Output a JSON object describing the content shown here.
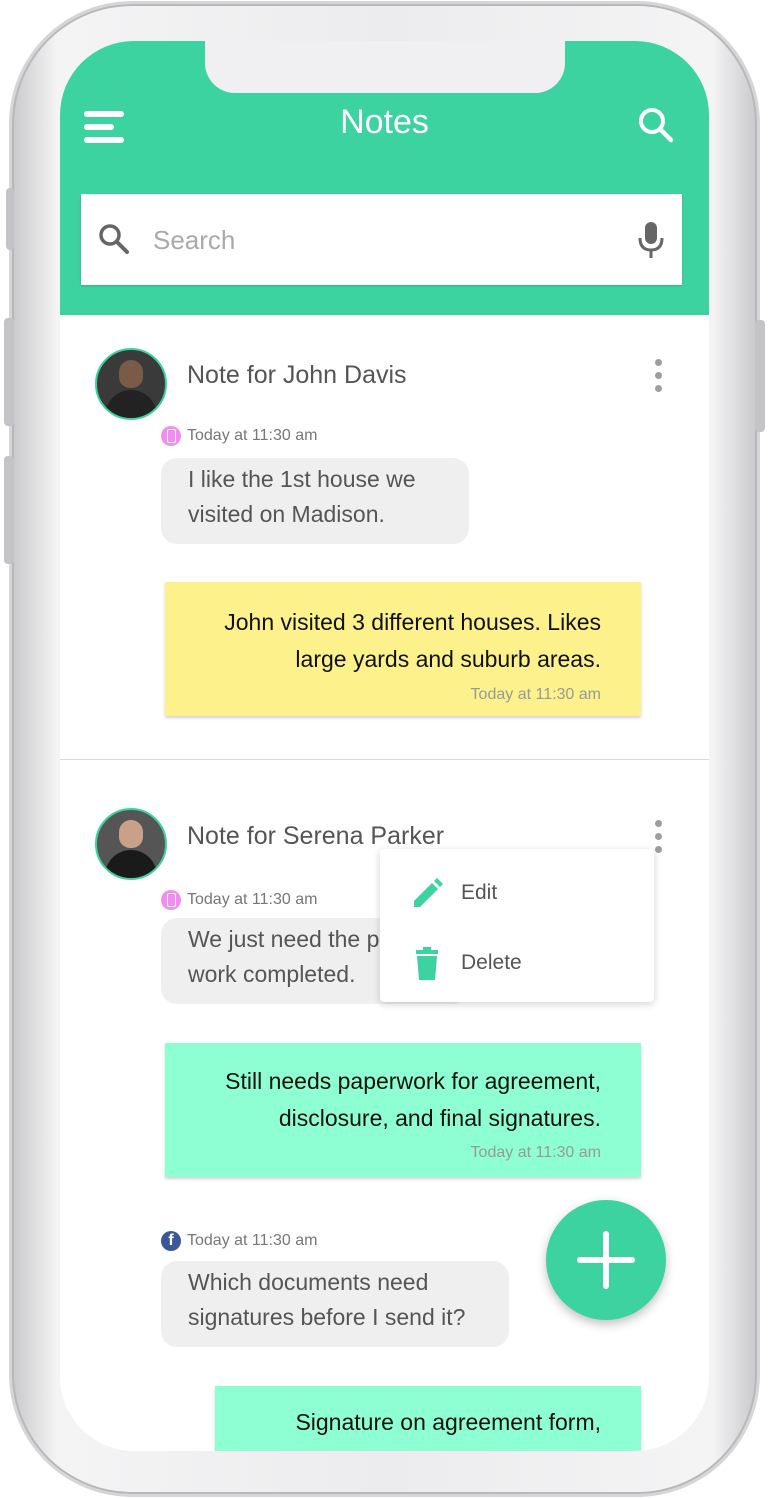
{
  "app": {
    "title": "Notes"
  },
  "search": {
    "placeholder": "Search"
  },
  "menu": {
    "edit": "Edit",
    "delete": "Delete"
  },
  "notes": [
    {
      "title": "Note for John Davis",
      "message": {
        "source": "phone",
        "time": "Today at 11:30 am",
        "lines": [
          "I like the 1st house we",
          "visited on Madison."
        ]
      },
      "sticky": {
        "color": "#fdf18c",
        "lines": [
          "John visited 3 different houses. Likes",
          "large yards and suburb areas."
        ],
        "time": "Today at 11:30 am"
      }
    },
    {
      "title": "Note for Serena Parker",
      "message": {
        "source": "phone",
        "time": "Today at 11:30 am",
        "lines": [
          "We just need the p",
          "work completed."
        ]
      },
      "sticky": {
        "color": "#8effd2",
        "lines": [
          "Still needs paperwork for agreement,",
          "disclosure, and final signatures."
        ],
        "time": "Today at 11:30 am"
      },
      "message2": {
        "source": "facebook",
        "time": "Today at 11:30 am",
        "lines": [
          "Which documents need",
          "signatures before I send it?"
        ]
      },
      "sticky2": {
        "color": "#8effd2",
        "lines": [
          "Signature on agreement form,"
        ]
      }
    }
  ],
  "colors": {
    "accent": "#3cd3a0",
    "sticky_yellow": "#fdf18c",
    "sticky_mint": "#8effd2"
  },
  "icons": [
    "menu-icon",
    "search-icon",
    "microphone-icon",
    "more-vert-icon",
    "phone-source-icon",
    "facebook-icon",
    "pencil-icon",
    "trash-icon",
    "plus-icon"
  ]
}
